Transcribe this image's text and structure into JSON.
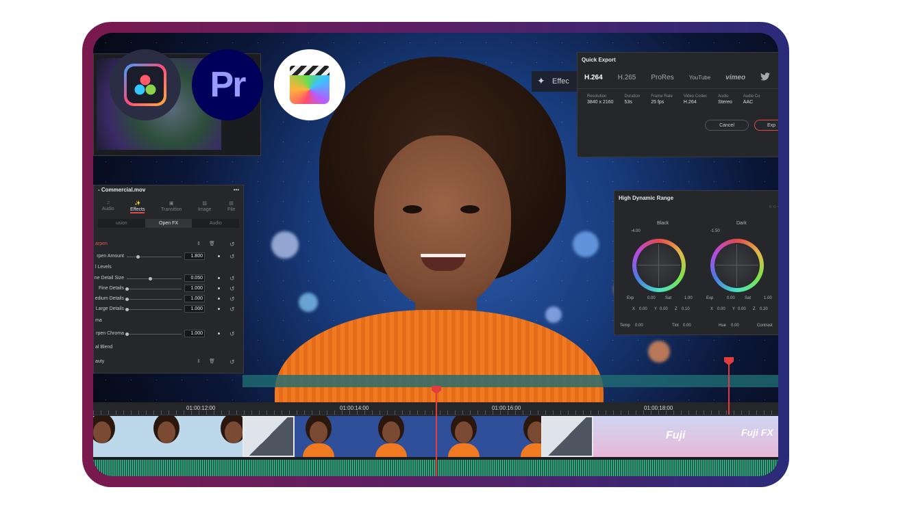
{
  "apps": {
    "davinci_label": "",
    "premiere_label": "Pr",
    "fcp_label": ""
  },
  "quick_export": {
    "title": "Quick Export",
    "tabs": [
      "H.264",
      "H.265",
      "ProRes",
      "YouTube",
      "vimeo",
      "twitter-icon"
    ],
    "fields": [
      {
        "label": "Resolution",
        "value": "3840 x 2160"
      },
      {
        "label": "Duration",
        "value": "53s"
      },
      {
        "label": "Frame Rate",
        "value": "25 fps"
      },
      {
        "label": "Video Codec",
        "value": "H.264"
      },
      {
        "label": "Audio",
        "value": "Stereo"
      },
      {
        "label": "Audio Co",
        "value": "AAC"
      }
    ],
    "cancel_label": "Cancel",
    "export_label": "Exp",
    "effects_label": "Effec"
  },
  "inspector": {
    "clip_title": "- Commercial.mov",
    "menu": "•••",
    "tabs": [
      {
        "icon": "♫",
        "label": "Audio"
      },
      {
        "icon": "✨",
        "label": "Effects"
      },
      {
        "icon": "▣",
        "label": "Transition"
      },
      {
        "icon": "▨",
        "label": "Image"
      },
      {
        "icon": "▤",
        "label": "File"
      }
    ],
    "subtabs": [
      "usion",
      "Open FX",
      "Audio"
    ],
    "section_sharpen": "arpen",
    "rows": [
      {
        "label": "rpen Amount",
        "value": "1.800"
      },
      {
        "label": "l Levels",
        "value": ""
      },
      {
        "label": "ne Detail Size",
        "value": "0.050"
      },
      {
        "label": "Fine Details",
        "value": "1.000"
      },
      {
        "label": "edium Details",
        "value": "1.000"
      },
      {
        "label": "Large Details",
        "value": "1.000"
      },
      {
        "label": "ma",
        "value": ""
      },
      {
        "label": "rpen Chroma",
        "value": "1.000"
      },
      {
        "label": "al Blend",
        "value": ""
      },
      {
        "label": "auty",
        "value": ""
      }
    ]
  },
  "hdr": {
    "title": "High Dynamic Range",
    "wheels": [
      {
        "name": "Black",
        "offset": "-4.00",
        "exp": "0.00",
        "sat": "1.00",
        "x": "0.00",
        "y": "0.00",
        "z": "0.10"
      },
      {
        "name": "Dark",
        "offset": "-1.50",
        "exp": "0.00",
        "sat": "1.00",
        "x": "0.00",
        "y": "0.00",
        "z": "0.20"
      }
    ],
    "exp_label": "Exp",
    "sat_label": "Sat",
    "x_label": "X",
    "y_label": "Y",
    "z_label": "Z",
    "temp_label": "Temp",
    "temp_value": "0.00",
    "tint_label": "Tint",
    "tint_value": "0.00",
    "hue_label": "Hue",
    "hue_value": "0.00",
    "contrast_label": "Contrast"
  },
  "timeline": {
    "timecodes": [
      "01:00:12:00",
      "01:00:14:00",
      "01:00:16:00",
      "01:00:18:00"
    ],
    "clip_text": "Fuji",
    "clip_text_2": "Fuji FX"
  },
  "colors": {
    "frame_left": "#7a1a4e",
    "frame_right": "#2a2b7a",
    "playhead": "#e23c3c",
    "accent_red": "#e24a4a",
    "audio_wave": "#4fd3a0"
  }
}
